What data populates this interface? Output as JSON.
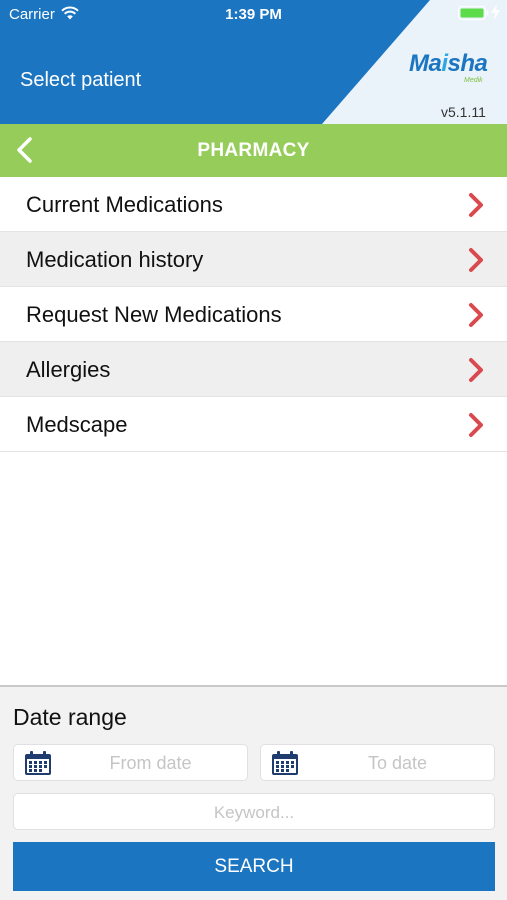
{
  "status_bar": {
    "carrier": "Carrier",
    "time": "1:39 PM"
  },
  "header": {
    "select_patient": "Select patient",
    "logo_main": "Ma",
    "logo_accent": "i",
    "logo_tail": "sha",
    "logo_sub": "Medik",
    "version": "v5.1.11"
  },
  "section": {
    "title": "PHARMACY"
  },
  "menu": {
    "items": [
      {
        "label": "Current Medications"
      },
      {
        "label": "Medication history"
      },
      {
        "label": "Request New Medications"
      },
      {
        "label": "Allergies"
      },
      {
        "label": "Medscape"
      }
    ]
  },
  "filters": {
    "date_range_label": "Date range",
    "from_placeholder": "From date",
    "to_placeholder": "To date",
    "keyword_placeholder": "Keyword...",
    "search_label": "SEARCH"
  },
  "colors": {
    "header_blue": "#1b75c0",
    "section_green": "#96cd5a",
    "chevron_red": "#d94a4f",
    "calendar_navy": "#1f3c6e"
  }
}
